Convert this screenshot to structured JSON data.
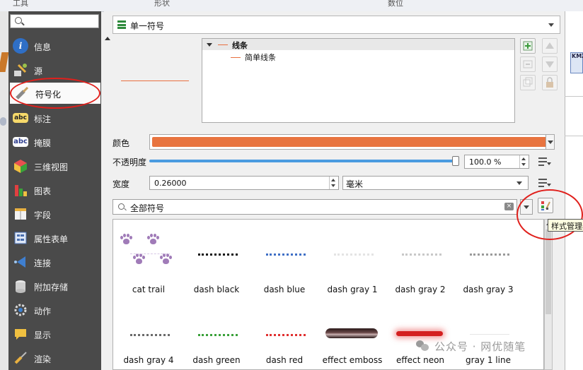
{
  "top_strip": {
    "items": [
      "工具",
      "形状",
      "数位"
    ]
  },
  "sidebar": {
    "search_placeholder": "",
    "items": [
      {
        "label": "信息",
        "icon": "info-icon"
      },
      {
        "label": "源",
        "icon": "source-wrench-icon"
      },
      {
        "label": "符号化",
        "icon": "paintbrush-icon",
        "selected": true
      },
      {
        "label": "标注",
        "icon": "abc-labels-icon"
      },
      {
        "label": "掩膜",
        "icon": "abc-mask-icon"
      },
      {
        "label": "三维视图",
        "icon": "3d-cube-icon"
      },
      {
        "label": "图表",
        "icon": "diagram-icon"
      },
      {
        "label": "字段",
        "icon": "fields-icon"
      },
      {
        "label": "属性表单",
        "icon": "attribute-form-icon"
      },
      {
        "label": "连接",
        "icon": "join-icon"
      },
      {
        "label": "附加存储",
        "icon": "auxiliary-storage-icon"
      },
      {
        "label": "动作",
        "icon": "actions-gear-icon"
      },
      {
        "label": "显示",
        "icon": "display-tip-icon"
      },
      {
        "label": "渲染",
        "icon": "rendering-brush-icon"
      }
    ]
  },
  "symbol_type": {
    "label": "单一符号"
  },
  "layer_tree": {
    "root": "线条",
    "child": "简单线条"
  },
  "properties": {
    "color_label": "颜色",
    "color_value": "#e8743f",
    "opacity_label": "不透明度",
    "opacity_value": "100.0 %",
    "opacity_fraction": 1.0,
    "width_label": "宽度",
    "width_value": "0.26000",
    "unit_value": "毫米"
  },
  "filter": {
    "value": "全部符号"
  },
  "tooltip": "样式管理器",
  "symbols": [
    {
      "label": "cat trail",
      "kind": "paws",
      "color": "#a07bb8"
    },
    {
      "label": "dash  black",
      "kind": "dash",
      "color": "#111111"
    },
    {
      "label": "dash blue",
      "kind": "dash",
      "color": "#3f6fc6"
    },
    {
      "label": "dash gray 1",
      "kind": "dash",
      "color": "#e4e4e4"
    },
    {
      "label": "dash gray 2",
      "kind": "dash",
      "color": "#c8c8c8"
    },
    {
      "label": "dash gray 3",
      "kind": "dash",
      "color": "#9a9a9a"
    },
    {
      "label": "dash gray 4",
      "kind": "dash",
      "color": "#6a6a6a"
    },
    {
      "label": "dash green",
      "kind": "dash",
      "color": "#3aa13a"
    },
    {
      "label": "dash red",
      "kind": "dash",
      "color": "#e03030"
    },
    {
      "label": "effect emboss",
      "kind": "emboss",
      "color": "#6b4a4a"
    },
    {
      "label": "effect neon",
      "kind": "neon",
      "color": "#d42020"
    },
    {
      "label": "gray 1 line",
      "kind": "solid",
      "color": "#e6e6e6"
    }
  ],
  "watermark": "公众号 · 网优随笔",
  "right_panel": {
    "badge": "KMZ"
  }
}
